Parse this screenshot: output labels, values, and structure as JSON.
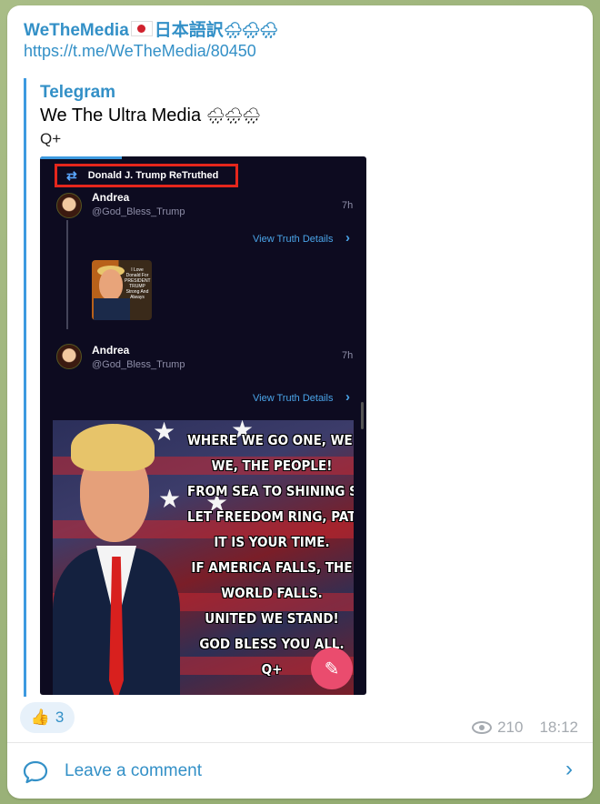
{
  "post": {
    "channel_name": "WeTheMedia",
    "channel_suffix": "日本語訳",
    "channel_emoji": "🌧🌧🌧",
    "link": "https://t.me/WeTheMedia/80450"
  },
  "quote": {
    "source": "Telegram",
    "title": "We The Ultra Media",
    "title_emoji": "🌧🌧🌧",
    "text": "Q+"
  },
  "screenshot": {
    "retruth_label": "Donald J. Trump ReTruthed",
    "user1": {
      "name": "Andrea",
      "handle": "@God_Bless_Trump",
      "time": "7h"
    },
    "user2": {
      "name": "Andrea",
      "handle": "@God_Bless_Trump",
      "time": "7h"
    },
    "view_details": "View Truth Details",
    "thumb_text": "I Love Donald For PRESIDENT TRUMP Strong And Always",
    "poster_lines": [
      "WHERE WE GO ONE, WE GO ALL!",
      "WE, THE PEOPLE!",
      "FROM SEA TO SHINING SEA.",
      "LET FREEDOM RING, PATRIOTS.",
      "IT IS YOUR TIME.",
      "IF AMERICA FALLS, THE",
      "WORLD FALLS.",
      "UNITED WE STAND!",
      "GOD BLESS YOU ALL.",
      "Q+"
    ]
  },
  "reaction": {
    "emoji": "👍",
    "count": "3"
  },
  "meta": {
    "views": "210",
    "time": "18:12"
  },
  "comments": {
    "label": "Leave a comment"
  },
  "colors": {
    "accent": "#3390c7",
    "retruth_border": "#e5261c",
    "fab": "#ea4c6e"
  },
  "icons": [
    "retruth-icon",
    "chevron-right-icon",
    "edit-pen-icon",
    "eye-icon",
    "comment-bubble-icon"
  ]
}
